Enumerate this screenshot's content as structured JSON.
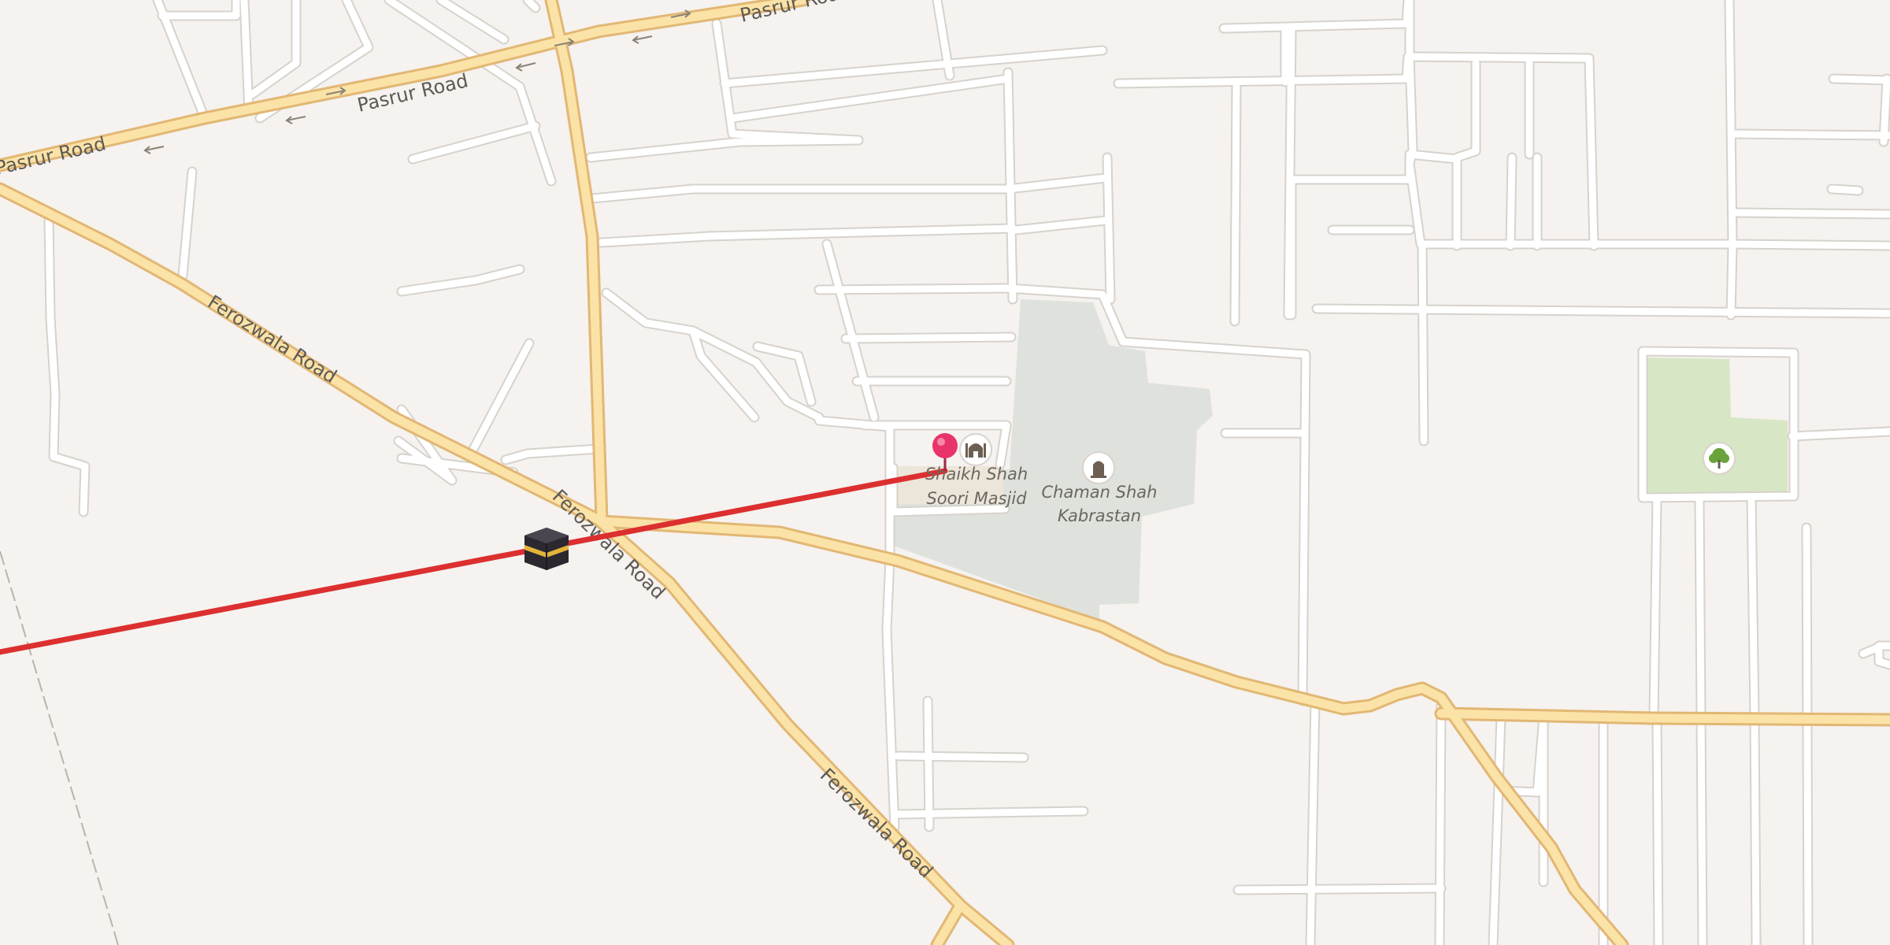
{
  "map": {
    "roads": [
      {
        "name": "Pasrur Road",
        "labels": [
          "Pasrur Road",
          "Pasrur Road",
          "Pasrur Road"
        ]
      },
      {
        "name": "Ferozwala Road",
        "labels": [
          "Ferozwala Road",
          "Ferozwala Road",
          "Ferozwala Road"
        ]
      }
    ],
    "pois": [
      {
        "name_line1": "Shaikh Shah",
        "name_line2": "Soori Masjid",
        "icon": "mosque-icon"
      },
      {
        "name_line1": "Chaman Shah",
        "name_line2": "Kabrastan",
        "icon": "cemetery-icon"
      },
      {
        "icon": "park-tree-icon"
      }
    ],
    "markers": [
      {
        "type": "location-pin",
        "color": "#e8336b"
      },
      {
        "type": "qibla-kaaba",
        "icon": "kaaba-icon"
      }
    ],
    "qibla_line_color": "#dc2f2f",
    "colors": {
      "background": "#f5f2ef",
      "major_road": "#fbe3a7",
      "minor_road": "#ffffff",
      "cemetery": "#dfe2dc",
      "park": "#d7e6c4"
    }
  }
}
